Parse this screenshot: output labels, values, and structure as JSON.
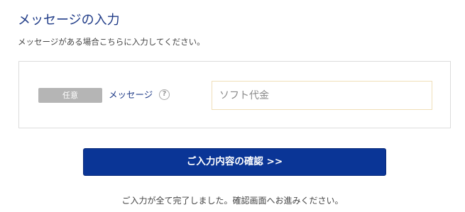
{
  "section": {
    "title": "メッセージの入力",
    "description": "メッセージがある場合こちらに入力してください。"
  },
  "form": {
    "message_field": {
      "badge": "任意",
      "label": "メッセージ",
      "help_glyph": "?",
      "help_icon": "question-circle-icon",
      "placeholder": "ソフト代金",
      "value": ""
    }
  },
  "actions": {
    "confirm_label": "ご入力内容の確認 >>",
    "complete_note": "ご入力が全て完了しました。確認画面へお進みください。"
  },
  "colors": {
    "title": "#1f3b87",
    "button_bg": "#0a3596",
    "badge_bg": "#b5b5b5",
    "input_border": "#f0dfb8",
    "box_border": "#dcdcdc"
  }
}
